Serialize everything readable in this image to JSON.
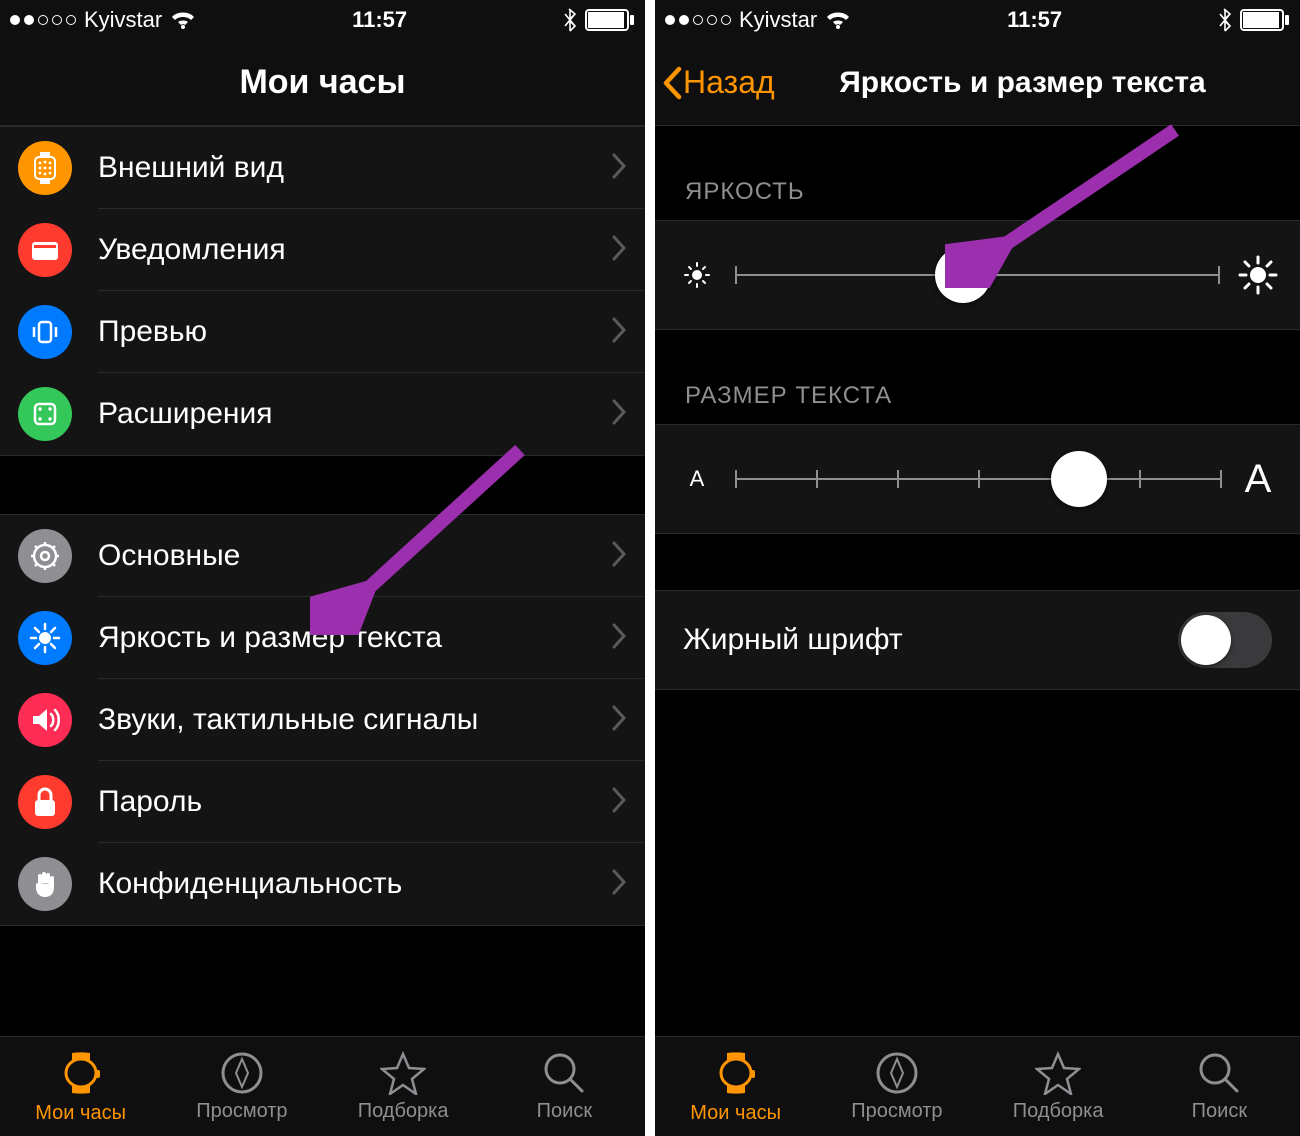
{
  "status": {
    "carrier": "Kyivstar",
    "time": "11:57",
    "signal_filled": 2,
    "signal_total": 5
  },
  "left": {
    "title": "Мои часы",
    "group1": [
      {
        "label": "Внешний вид",
        "icon": "watch-face-icon",
        "color": "ic-orange"
      },
      {
        "label": "Уведомления",
        "icon": "notifications-icon",
        "color": "ic-red"
      },
      {
        "label": "Превью",
        "icon": "preview-icon",
        "color": "ic-blue"
      },
      {
        "label": "Расширения",
        "icon": "complications-icon",
        "color": "ic-green"
      }
    ],
    "group2": [
      {
        "label": "Основные",
        "icon": "gear-icon",
        "color": "ic-gray"
      },
      {
        "label": "Яркость и размер текста",
        "icon": "brightness-icon",
        "color": "ic-blue"
      },
      {
        "label": "Звуки, тактильные сигналы",
        "icon": "sound-icon",
        "color": "ic-pink"
      },
      {
        "label": "Пароль",
        "icon": "lock-icon",
        "color": "ic-red"
      },
      {
        "label": "Конфиденциальность",
        "icon": "hand-icon",
        "color": "ic-gray"
      }
    ]
  },
  "right": {
    "back": "Назад",
    "title": "Яркость и размер текста",
    "brightness_label": "ЯРКОСТЬ",
    "brightness_pct": 47,
    "textsize_label": "РАЗМЕР ТЕКСТА",
    "textsize_pct": 71,
    "textsize_steps": 7,
    "bold_label": "Жирный шрифт",
    "bold_on": false
  },
  "tabs": [
    {
      "label": "Мои часы",
      "icon": "watch-tab-icon",
      "active": true
    },
    {
      "label": "Просмотр",
      "icon": "compass-icon",
      "active": false
    },
    {
      "label": "Подборка",
      "icon": "star-icon",
      "active": false
    },
    {
      "label": "Поиск",
      "icon": "search-icon",
      "active": false
    }
  ],
  "annotations": {
    "arrow_color": "#9b2fae"
  }
}
